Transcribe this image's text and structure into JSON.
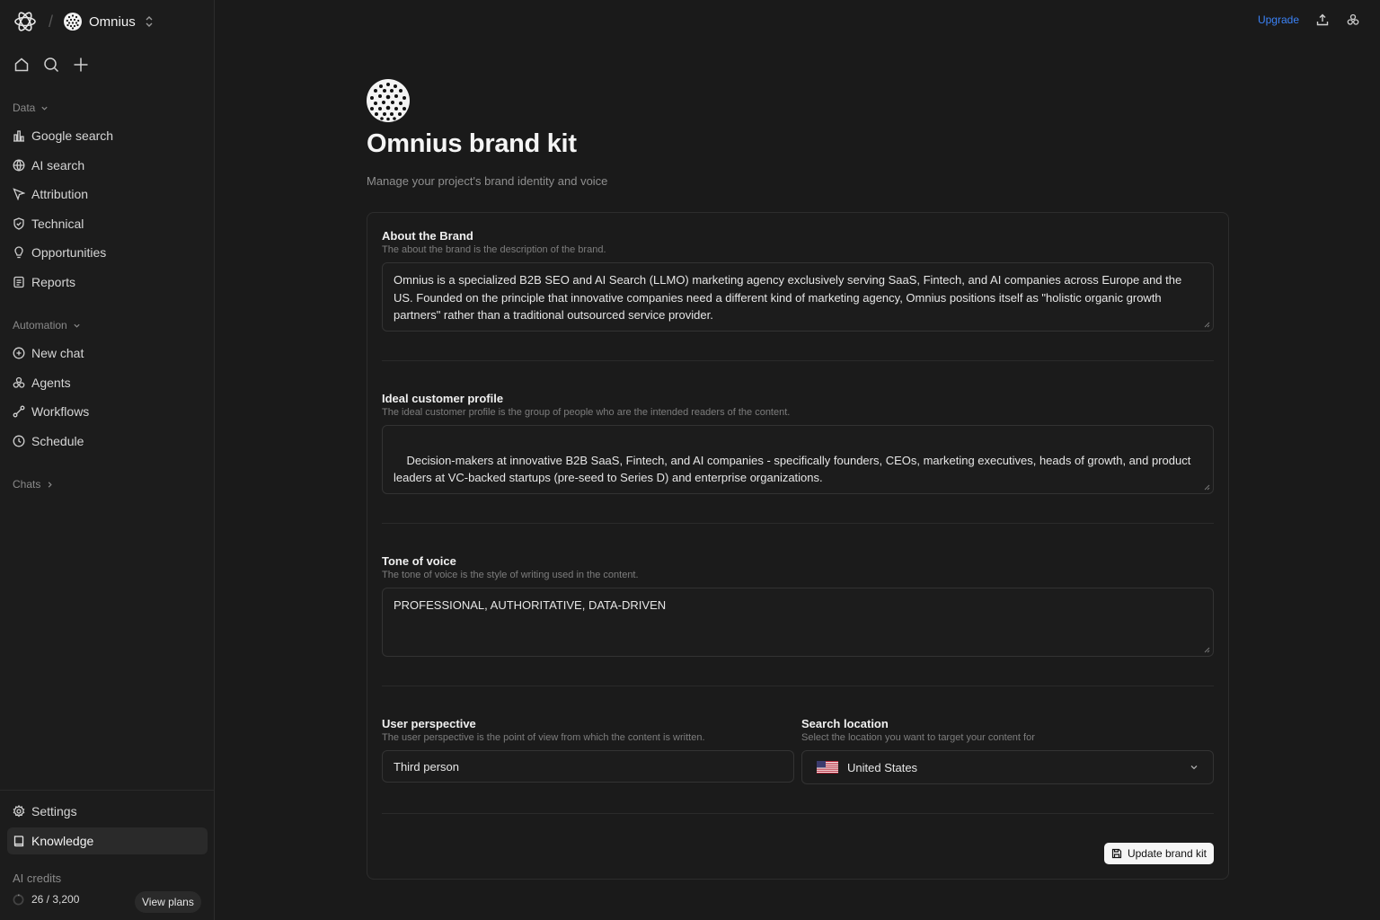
{
  "sidebar": {
    "project_name": "Omnius",
    "sections": {
      "data": "Data",
      "automation": "Automation",
      "chats": "Chats"
    },
    "data_items": [
      {
        "label": "Google search",
        "icon": "bar-chart-icon"
      },
      {
        "label": "AI search",
        "icon": "globe-icon"
      },
      {
        "label": "Attribution",
        "icon": "cursor-icon"
      },
      {
        "label": "Technical",
        "icon": "shield-check-icon"
      },
      {
        "label": "Opportunities",
        "icon": "lightbulb-icon"
      },
      {
        "label": "Reports",
        "icon": "file-text-icon"
      }
    ],
    "automation_items": [
      {
        "label": "New chat",
        "icon": "chat-plus-icon"
      },
      {
        "label": "Agents",
        "icon": "agents-icon"
      },
      {
        "label": "Workflows",
        "icon": "workflow-icon"
      },
      {
        "label": "Schedule",
        "icon": "clock-icon"
      }
    ],
    "bottom_items": [
      {
        "label": "Settings",
        "icon": "gear-icon"
      },
      {
        "label": "Knowledge",
        "icon": "book-icon"
      }
    ],
    "credits_label": "AI credits",
    "credits_value": "26 / 3,200",
    "view_plans": "View plans"
  },
  "header": {
    "upgrade": "Upgrade"
  },
  "page": {
    "title": "Omnius brand kit",
    "subtitle": "Manage your project's brand identity and voice"
  },
  "form": {
    "about": {
      "label": "About the Brand",
      "help": "The about the brand is the description of the brand.",
      "value": "Omnius is a specialized B2B SEO and AI Search (LLMO) marketing agency exclusively serving SaaS, Fintech, and AI companies across Europe and the US. Founded on the principle that innovative companies need a different kind of marketing agency, Omnius positions itself as \"holistic organic growth partners\" rather than a traditional outsourced service provider."
    },
    "icp": {
      "label": "Ideal customer profile",
      "help": "The ideal customer profile is the group of people who are the intended readers of the content.",
      "value": "Decision-makers at innovative B2B SaaS, Fintech, and AI companies - specifically founders, CEOs, marketing executives, heads of growth, and product leaders at VC-backed startups (pre-seed to Series D) and enterprise organizations.\n\nPrimary audience segments:"
    },
    "tone": {
      "label": "Tone of voice",
      "help": "The tone of voice is the style of writing used in the content.",
      "value": "PROFESSIONAL, AUTHORITATIVE, DATA-DRIVEN"
    },
    "perspective": {
      "label": "User perspective",
      "help": "The user perspective is the point of view from which the content is written.",
      "value": "Third person"
    },
    "location": {
      "label": "Search location",
      "help": "Select the location you want to target your content for",
      "value": "United States"
    },
    "submit": "Update brand kit"
  }
}
